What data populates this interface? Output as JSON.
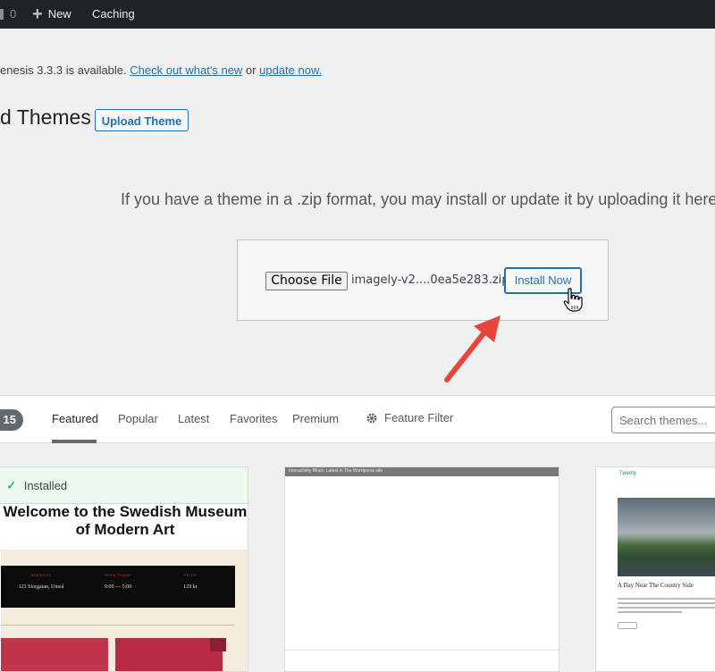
{
  "adminbar": {
    "comment_count": "0",
    "new_label": "New",
    "caching_label": "Caching"
  },
  "notice": {
    "text": "enesis 3.3.3 is available. ",
    "link1": "Check out what's new",
    "middle": " or ",
    "link2": "update now."
  },
  "page": {
    "title": "d Themes",
    "upload_button": "Upload Theme",
    "help_text": "If you have a theme in a .zip format, you may install or update it by uploading it here."
  },
  "upload": {
    "choose_file": "Choose File",
    "file_name": "imagely-v2....0ea5e283.zip",
    "install_button": "Install Now"
  },
  "filters": {
    "count": "15",
    "items": [
      "Featured",
      "Popular",
      "Latest",
      "Favorites",
      "Premium"
    ],
    "feature_filter": "Feature Filter",
    "search_placeholder": "Search themes..."
  },
  "themes": {
    "installed_label": "Installed",
    "card1_headline": "Welcome to the Swedish Museum of Modern Art",
    "card1_band": [
      {
        "label": "ADDRESS",
        "value": "123 Storgatan, Umeå"
      },
      {
        "label": "OPEN TODAY",
        "value": "9:00 — 5:00"
      },
      {
        "label": "PRICE",
        "value": "129 kr"
      }
    ],
    "card2_bar": "Interactivity Block: Latest in The Wordpress site",
    "card3_logo": "Twenty",
    "card3_post_title": "A Day Near The Country Side"
  },
  "colors": {
    "accent": "#2271b1",
    "adminbar": "#1d2327",
    "arrow": "#e8453c",
    "installed_bg": "#edfaef"
  }
}
